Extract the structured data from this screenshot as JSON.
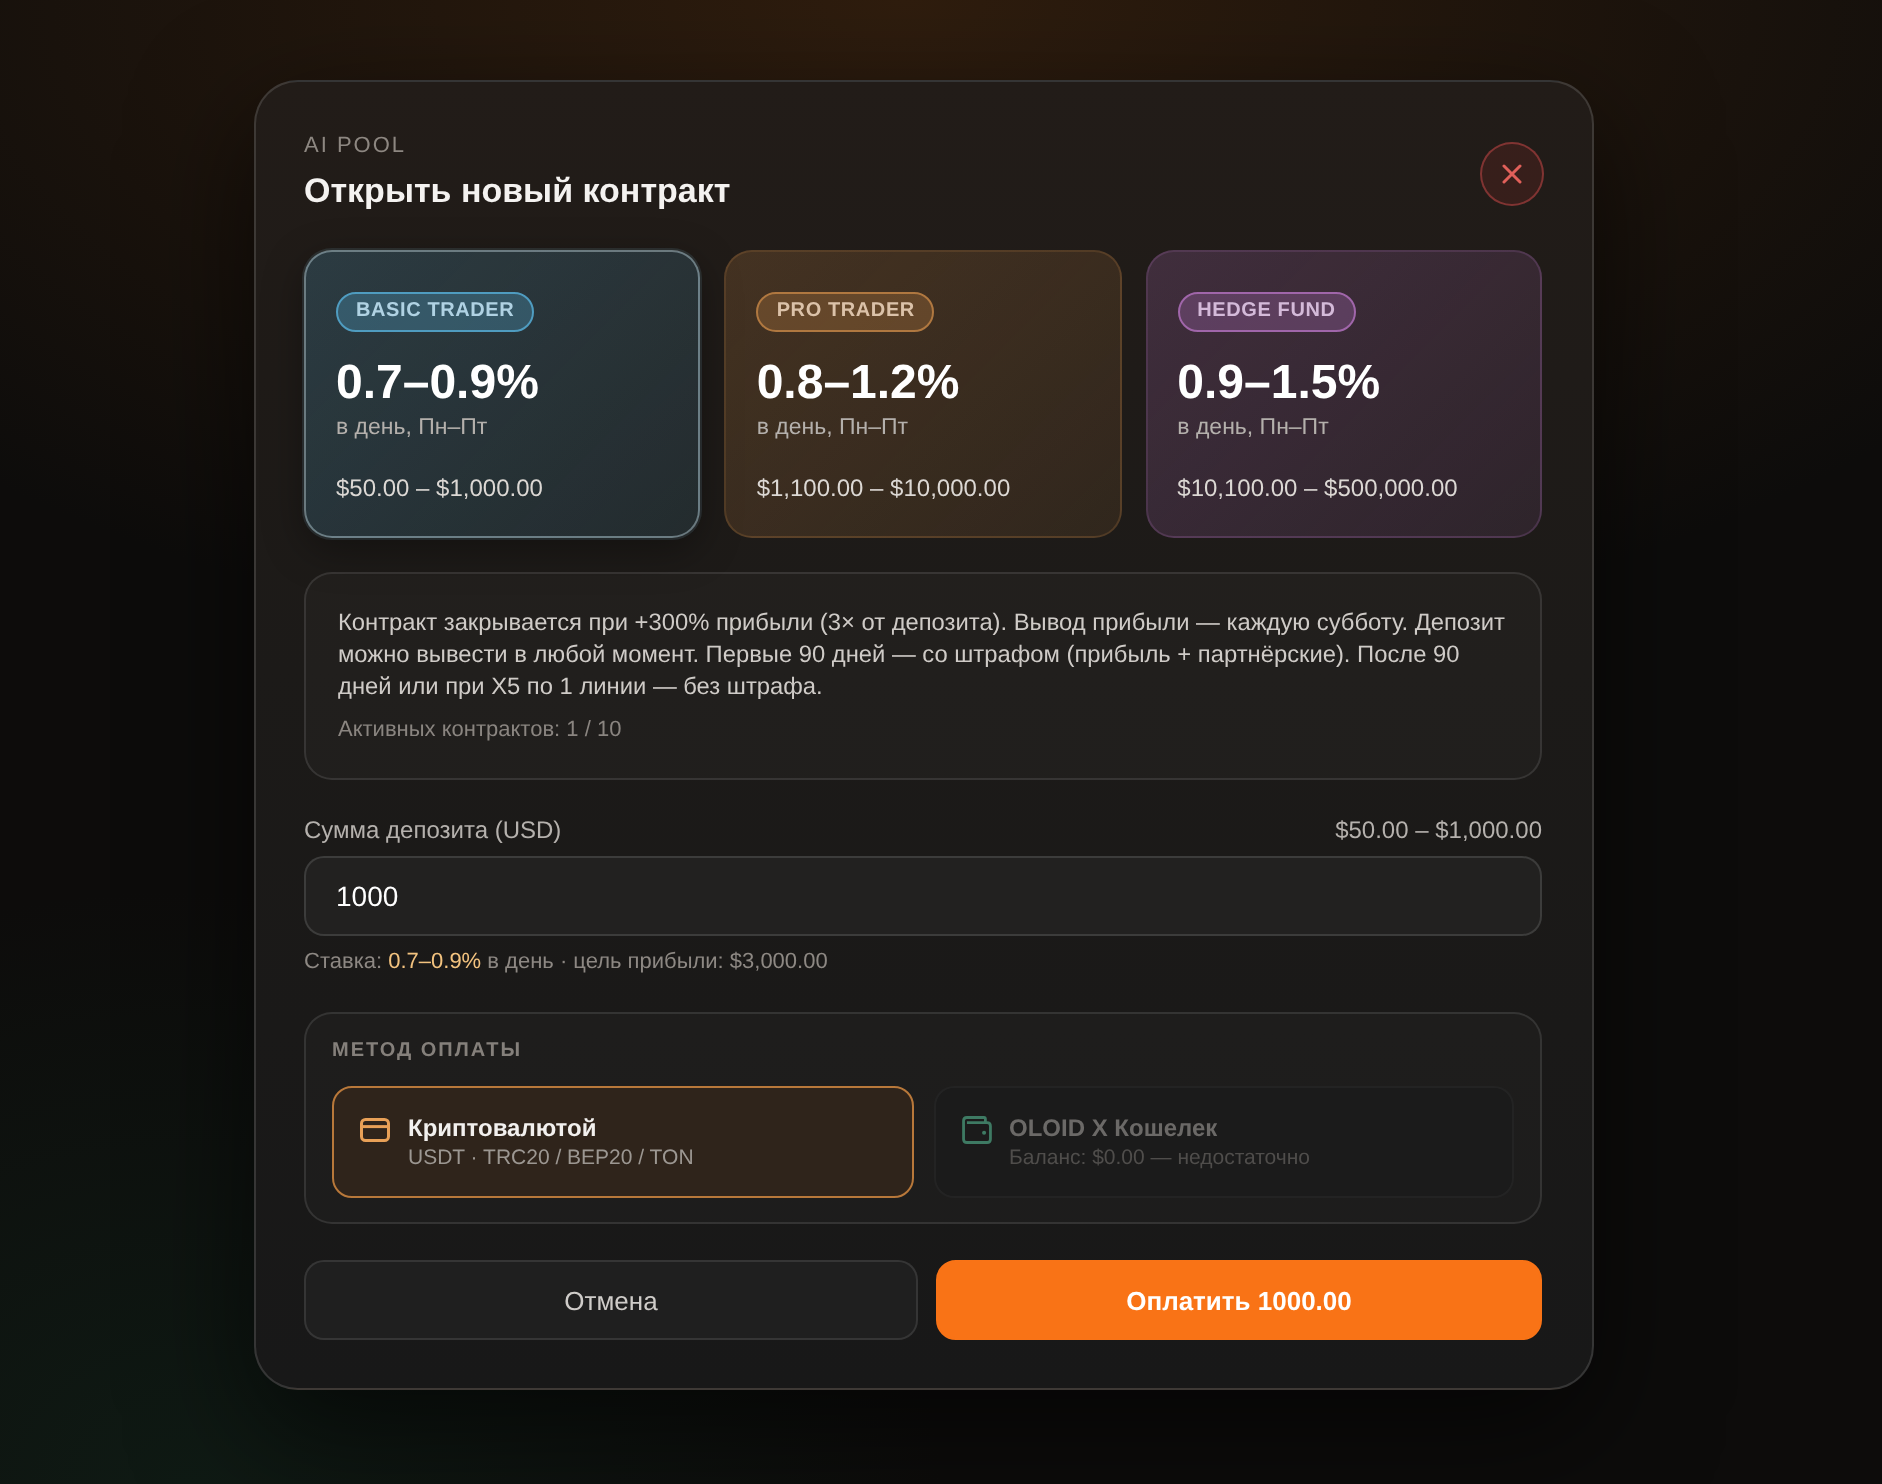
{
  "header": {
    "eyebrow": "AI POOL",
    "title": "Открыть новый контракт"
  },
  "plans": [
    {
      "badge": "BASIC TRADER",
      "rate": "0.7–0.9%",
      "schedule": "в день, Пн–Пт",
      "range": "$50.00 – $1,000.00",
      "color": "#4f9cc0",
      "selected": true
    },
    {
      "badge": "PRO TRADER",
      "rate": "0.8–1.2%",
      "schedule": "в день, Пн–Пт",
      "range": "$1,100.00 – $10,000.00",
      "color": "#b07840",
      "selected": false
    },
    {
      "badge": "HEDGE FUND",
      "rate": "0.9–1.5%",
      "schedule": "в день, Пн–Пт",
      "range": "$10,100.00 – $500,000.00",
      "color": "#a066aa",
      "selected": false
    }
  ],
  "info": {
    "text": "Контракт закрывается при +300% прибыли (3× от депозита). Вывод прибыли — каждую субботу. Депозит можно вывести в любой момент. Первые 90 дней — со штрафом (прибыль + партнёрские). После 90 дней или при X5 по 1 линии — без штрафа.",
    "active": "Активных контрактов: 1 / 10"
  },
  "deposit": {
    "label": "Сумма депозита (USD)",
    "range": "$50.00 – $1,000.00",
    "value": "1000",
    "hint": "Ставка: **0.7–0.9%** в день · цель прибыли: $3,000.00"
  },
  "payment": {
    "label": "МЕТОД ОПЛАТЫ",
    "options": [
      {
        "kind": "card",
        "title": "Криптовалютой",
        "subtitle": "USDT · TRC20 / BEP20 / TON",
        "selected": true,
        "disabled": false
      },
      {
        "kind": "wallet",
        "title": "OLOID X Кошелек",
        "subtitle": "Баланс: $0.00 — недостаточно",
        "selected": false,
        "disabled": true
      }
    ]
  },
  "buttons": [
    {
      "kind": "secondary",
      "label": "Отмена"
    },
    {
      "kind": "primary",
      "label": "Оплатить 1000.00"
    }
  ]
}
